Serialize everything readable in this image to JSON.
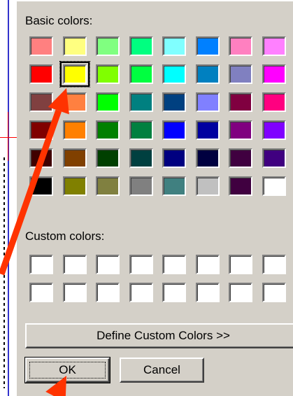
{
  "dialog": {
    "basic_colors_label": "Basic colors:",
    "custom_colors_label": "Custom colors:",
    "define_custom_button": "Define Custom Colors >>",
    "ok_button": "OK",
    "cancel_button": "Cancel",
    "selected_color": "#FFFF00"
  },
  "basic_colors": [
    [
      "#FF8080",
      "#FFFF80",
      "#80FF80",
      "#00FF80",
      "#80FFFF",
      "#0080FF",
      "#FF80C0",
      "#FF80FF"
    ],
    [
      "#FF0000",
      "#FFFF00",
      "#80FF00",
      "#00FF40",
      "#00FFFF",
      "#0080C0",
      "#8080C0",
      "#FF00FF"
    ],
    [
      "#804040",
      "#FF8040",
      "#00FF00",
      "#008080",
      "#004080",
      "#8080FF",
      "#800040",
      "#FF0080"
    ],
    [
      "#800000",
      "#FF8000",
      "#008000",
      "#008040",
      "#0000FF",
      "#0000A0",
      "#800080",
      "#8000FF"
    ],
    [
      "#400000",
      "#804000",
      "#004000",
      "#004040",
      "#000080",
      "#000040",
      "#400040",
      "#400080"
    ],
    [
      "#000000",
      "#808000",
      "#808040",
      "#808080",
      "#408080",
      "#C0C0C0",
      "#400040",
      "#FFFFFF"
    ]
  ],
  "custom_colors": [
    [
      "#FFFFFF",
      "#FFFFFF",
      "#FFFFFF",
      "#FFFFFF",
      "#FFFFFF",
      "#FFFFFF",
      "#FFFFFF",
      "#FFFFFF"
    ],
    [
      "#FFFFFF",
      "#FFFFFF",
      "#FFFFFF",
      "#FFFFFF",
      "#FFFFFF",
      "#FFFFFF",
      "#FFFFFF",
      "#FFFFFF"
    ]
  ],
  "annotation": {
    "arrow_color": "#FF3300"
  }
}
